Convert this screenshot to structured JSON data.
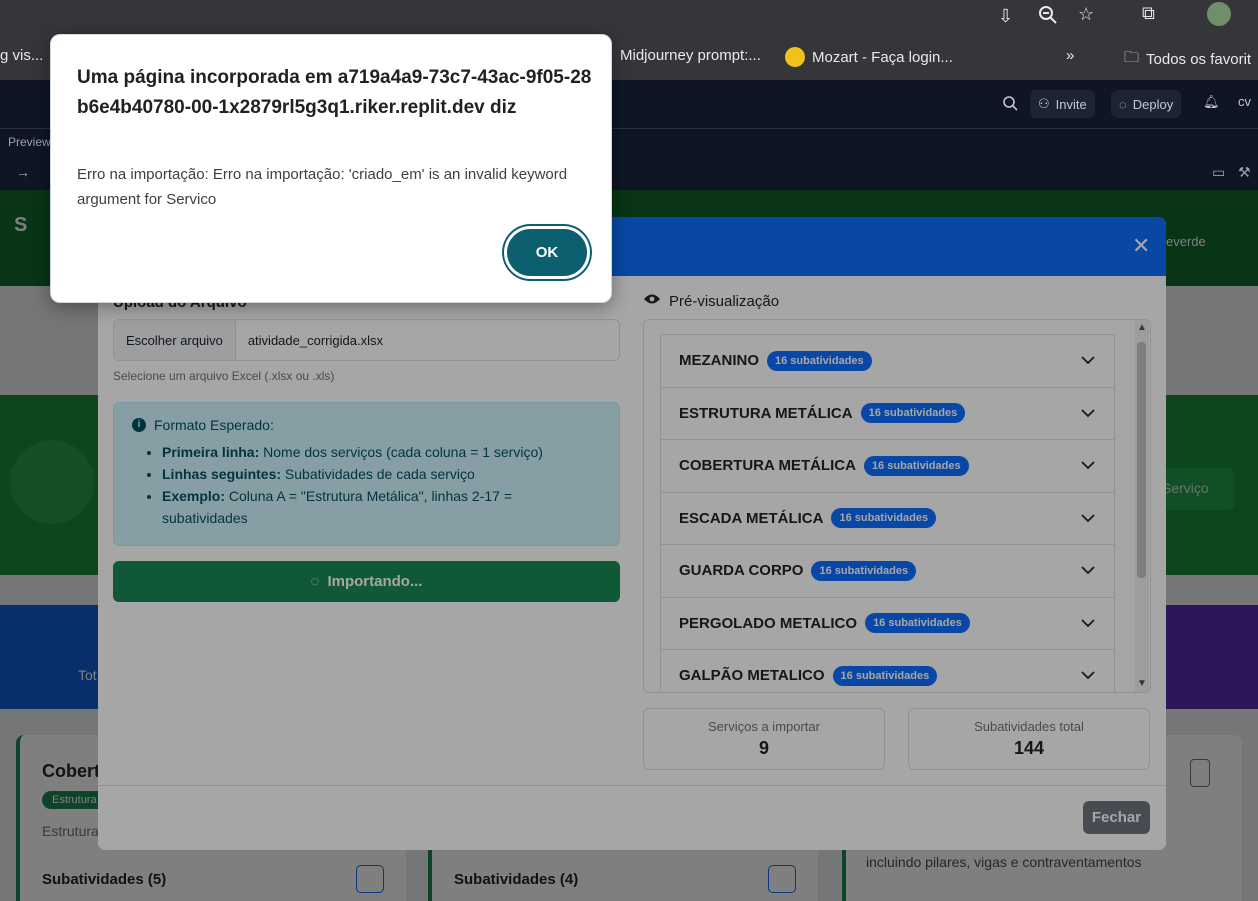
{
  "bookmarks": [
    {
      "label": "g vis..."
    },
    {
      "label": "Midjourney prompt:..."
    },
    {
      "label": "Mozart - Faça login..."
    },
    {
      "label": "»"
    },
    {
      "label": "Todos os favorit"
    }
  ],
  "replit": {
    "invite_label": "Invite",
    "deploy_label": "Deploy",
    "avatar_initials": "cv",
    "tab_label": "Preview"
  },
  "app": {
    "brand_initial": "S",
    "user_suffix": "everde",
    "hero_button": "Serviço",
    "stats_text": "Tot",
    "card1": {
      "title": "Cobert",
      "tag": "Estrutura",
      "desc": "Estrutura",
      "subs": "Subatividades (5)"
    },
    "card2": {
      "subs": "Subatividades (4)"
    },
    "card3": {
      "desc": "incluindo pilares, vigas e contraventamentos",
      "subs": "Subatividades (4)"
    }
  },
  "modal": {
    "upload_label": "Upload do Arquivo",
    "file_button": "Escolher arquivo",
    "file_name": "atividade_corrigida.xlsx",
    "file_help": "Selecione um arquivo Excel (.xlsx ou .xls)",
    "info": {
      "title": "Formato Esperado:",
      "items": [
        {
          "bold": "Primeira linha:",
          "text": " Nome dos serviços (cada coluna = 1 serviço)"
        },
        {
          "bold": "Linhas seguintes:",
          "text": " Subatividades de cada serviço"
        },
        {
          "bold": "Exemplo:",
          "text": " Coluna A = \"Estrutura Metálica\", linhas 2-17 = subatividades"
        }
      ]
    },
    "import_button": "Importando...",
    "preview_label": "Pré-visualização",
    "services": [
      {
        "name": "MEZANINO",
        "badge": "16 subatividades"
      },
      {
        "name": "ESTRUTURA METÁLICA",
        "badge": "16 subatividades"
      },
      {
        "name": "COBERTURA METÁLICA",
        "badge": "16 subatividades"
      },
      {
        "name": "ESCADA METÁLICA",
        "badge": "16 subatividades"
      },
      {
        "name": "GUARDA CORPO",
        "badge": "16 subatividades"
      },
      {
        "name": "PERGOLADO METALICO",
        "badge": "16 subatividades"
      },
      {
        "name": "GALPÃO METALICO",
        "badge": "16 subatividades"
      }
    ],
    "stats": {
      "services_label": "Serviços a importar",
      "services_value": "9",
      "subs_label": "Subatividades total",
      "subs_value": "144"
    },
    "close_button": "Fechar"
  },
  "alert": {
    "title": "Uma página incorporada em a719a4a9-73c7-43ac-9f05-28b6e4b40780-00-1x2879rl5g3q1.riker.replit.dev diz",
    "message": "Erro na importação: Erro na importação: 'criado_em' is an invalid keyword argument for Servico",
    "ok_button": "OK"
  }
}
